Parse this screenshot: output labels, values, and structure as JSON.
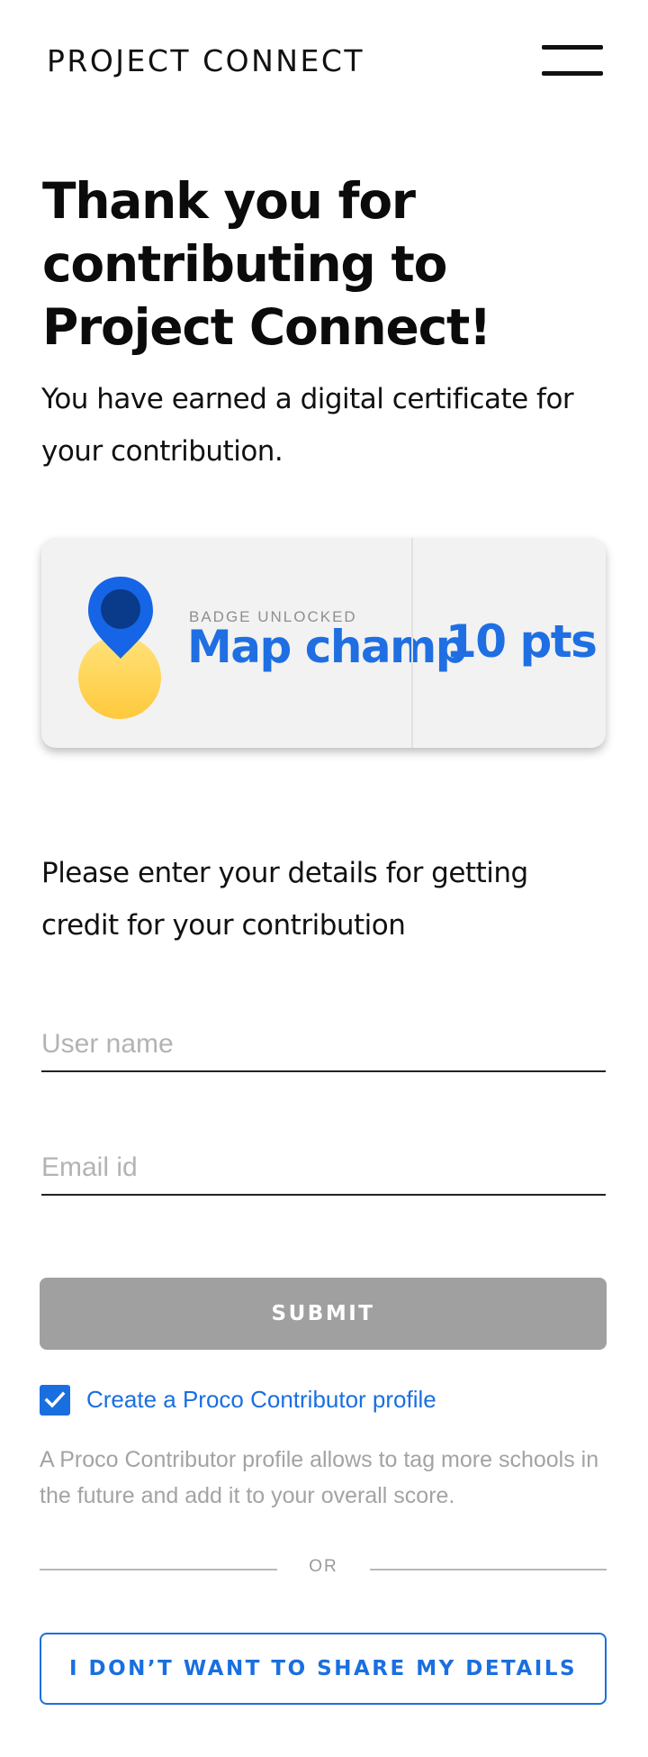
{
  "header": {
    "brand": "PROJECT CONNECT",
    "menu_icon": "hamburger-menu-icon"
  },
  "main": {
    "title": "Thank you for contributing to Project Connect!",
    "subtitle": "You have earned a digital certificate for your contribution.",
    "badge": {
      "icon": "map-pin-icon",
      "kicker": "BADGE UNLOCKED",
      "name": "Map champ",
      "points": "10 pts"
    },
    "prompt": "Please enter your details for getting credit for your contribution",
    "form": {
      "username_placeholder": "User name",
      "email_placeholder": "Email id",
      "submit_label": "SUBMIT",
      "checkbox_checked": true,
      "checkbox_label": "Create a Proco Contributor profile",
      "helper_text": "A Proco Contributor profile allows to tag more schools in the future and add it to your overall score.",
      "divider_text": "OR",
      "decline_label": "I DON’T WANT TO SHARE MY DETAILS"
    }
  },
  "colors": {
    "accent": "#1a6fe0",
    "badge_text": "#1f6fe3",
    "submit_disabled": "#a0a0a0",
    "placeholder": "#b3b3b3",
    "pin_blue": "#1565e6",
    "pin_dark": "#0a3a8a",
    "coin_yellow": "#ffd54f"
  }
}
